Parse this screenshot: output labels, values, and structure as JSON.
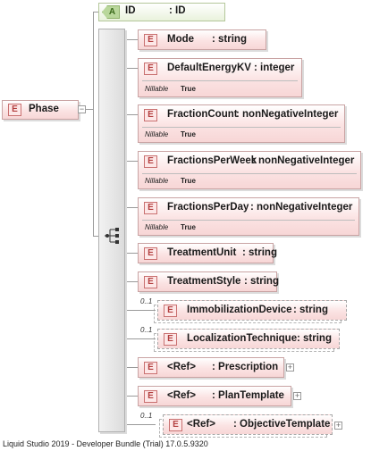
{
  "root": {
    "badge": "E",
    "name": "Phase"
  },
  "attribute": {
    "badge": "A",
    "name": "ID",
    "type": ": ID"
  },
  "elements": [
    {
      "badge": "E",
      "name": "Mode",
      "type": ": string"
    },
    {
      "badge": "E",
      "name": "DefaultEnergyKV",
      "type": ": integer",
      "ann_key": "Nillable",
      "ann_val": "True"
    },
    {
      "badge": "E",
      "name": "FractionCount",
      "type": ": nonNegativeInteger",
      "ann_key": "Nillable",
      "ann_val": "True"
    },
    {
      "badge": "E",
      "name": "FractionsPerWeek",
      "type": ": nonNegativeInteger",
      "ann_key": "Nillable",
      "ann_val": "True"
    },
    {
      "badge": "E",
      "name": "FractionsPerDay",
      "type": ": nonNegativeInteger",
      "ann_key": "Nillable",
      "ann_val": "True"
    },
    {
      "badge": "E",
      "name": "TreatmentUnit",
      "type": ": string"
    },
    {
      "badge": "E",
      "name": "TreatmentStyle",
      "type": ": string"
    },
    {
      "badge": "E",
      "name": "ImmobilizationDevice",
      "type": ": string",
      "occurs": "0..1"
    },
    {
      "badge": "E",
      "name": "LocalizationTechnique",
      "type": ": string",
      "occurs": "0..1"
    },
    {
      "badge": "E",
      "name": "<Ref>",
      "type": ": Prescription"
    },
    {
      "badge": "E",
      "name": "<Ref>",
      "type": ": PlanTemplate"
    },
    {
      "badge": "E",
      "name": "<Ref>",
      "type": ": ObjectiveTemplate",
      "occurs": "0..1"
    }
  ],
  "footer": "Liquid Studio 2019 - Developer Bundle (Trial) 17.0.5.9320"
}
